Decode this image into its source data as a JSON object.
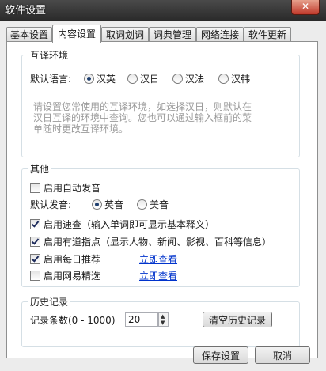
{
  "window": {
    "title": "软件设置",
    "close_label": "✕"
  },
  "tabs": [
    {
      "label": "基本设置",
      "active": false
    },
    {
      "label": "内容设置",
      "active": true
    },
    {
      "label": "取词划词",
      "active": false
    },
    {
      "label": "词典管理",
      "active": false
    },
    {
      "label": "网络连接",
      "active": false
    },
    {
      "label": "软件更新",
      "active": false
    }
  ],
  "translation_env": {
    "title": "互译环境",
    "default_language_label": "默认语言:",
    "options": [
      {
        "label": "汉英",
        "selected": true
      },
      {
        "label": "汉日",
        "selected": false
      },
      {
        "label": "汉法",
        "selected": false
      },
      {
        "label": "汉韩",
        "selected": false
      }
    ],
    "hint_lines": [
      "请设置您常使用的互译环境，如选择汉日，则默认在",
      "汉日互译的环境中查询。您也可以通过输入框前的菜",
      "单随时更改互译环境。"
    ]
  },
  "other": {
    "title": "其他",
    "auto_pronounce": {
      "label": "启用自动发音",
      "checked": false
    },
    "default_pronounce_label": "默认发音:",
    "pronounce_options": [
      {
        "label": "英音",
        "selected": true
      },
      {
        "label": "美音",
        "selected": false
      }
    ],
    "quick_lookup": {
      "label": "启用速查（输入单词即可显示基本释义）",
      "checked": true
    },
    "youdao_guide": {
      "label": "启用有道指点（显示人物、新闻、影视、百科等信息）",
      "checked": true
    },
    "daily_recommend": {
      "label": "启用每日推荐",
      "checked": true,
      "link": "立即查看"
    },
    "netease_picks": {
      "label": "启用网易精选",
      "checked": false,
      "link": "立即查看"
    }
  },
  "history": {
    "title": "历史记录",
    "count_label": "记录条数(0 - 1000)",
    "count_value": "20",
    "clear_button": "清空历史记录"
  },
  "footer": {
    "save_button": "保存设置",
    "cancel_button": "取消"
  }
}
